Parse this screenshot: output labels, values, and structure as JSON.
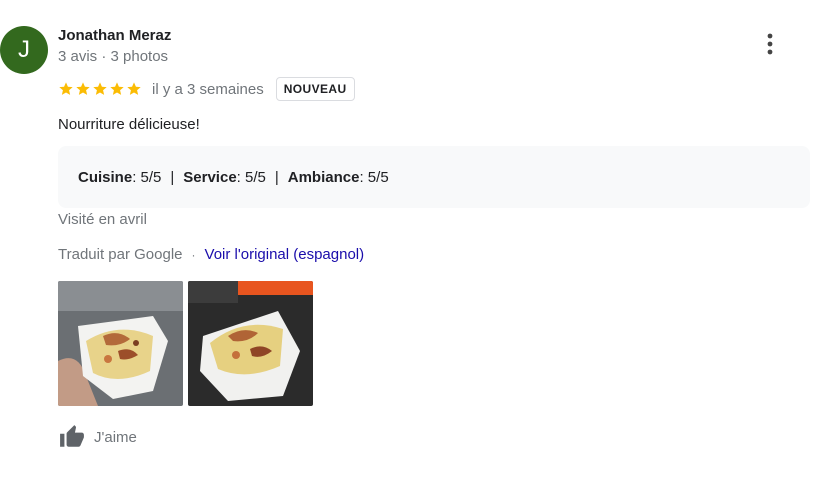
{
  "reviewer": {
    "initial": "J",
    "name": "Jonathan Meraz",
    "meta": "3 avis · 3 photos",
    "avatar_color": "#33691e"
  },
  "menu_icon": "more-vert-icon",
  "rating": {
    "stars": 5,
    "star_color": "#fbbc04",
    "date": "il y a 3 semaines",
    "badge": "NOUVEAU"
  },
  "review_text": "Nourriture délicieuse!",
  "attributes": [
    {
      "label": "Cuisine",
      "value": " : 5/5"
    },
    {
      "label": "Service",
      "value": " : 5/5"
    },
    {
      "label": "Ambiance",
      "value": " : 5/5"
    }
  ],
  "attribute_separator": "|",
  "visited": "Visité en avril",
  "translation": {
    "text": "Traduit par Google",
    "separator": "·",
    "link": "Voir l'original (espagnol)",
    "link_color": "#1a0dab"
  },
  "photos": [
    "review-photo-1",
    "review-photo-2"
  ],
  "like": {
    "label": "J'aime",
    "icon": "thumbs-up-icon"
  }
}
